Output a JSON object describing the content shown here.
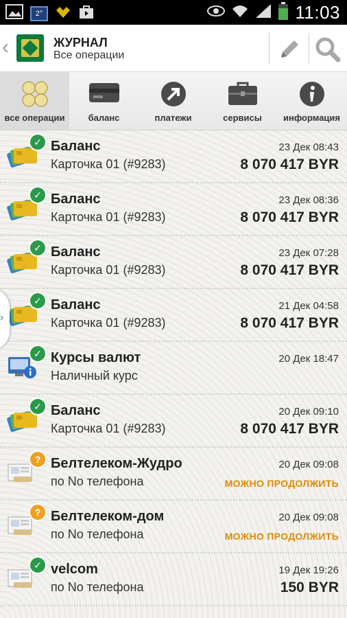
{
  "statusbar": {
    "temp": "2°",
    "time": "11:03",
    "icons": [
      "gallery-icon",
      "temperature-icon",
      "heart-icon",
      "store-icon",
      "eye-icon",
      "wifi-icon",
      "signal-icon",
      "battery-icon"
    ]
  },
  "appbar": {
    "title": "ЖУРНАЛ",
    "subtitle": "Все операции",
    "icons": [
      "back-icon",
      "bank-logo",
      "pencil-icon",
      "search-icon"
    ]
  },
  "tabs": [
    {
      "label": "все операции",
      "icon": "all-operations-icon",
      "active": true
    },
    {
      "label": "баланс",
      "icon": "card-icon",
      "active": false
    },
    {
      "label": "платежи",
      "icon": "payment-arrow-icon",
      "active": false
    },
    {
      "label": "сервисы",
      "icon": "briefcase-icon",
      "active": false
    },
    {
      "label": "информация",
      "icon": "info-icon",
      "active": false
    }
  ],
  "operations": [
    {
      "name": "Баланс",
      "desc": "Карточка 01 (#9283)",
      "date": "23 Дек 08:43",
      "amount": "8 070 417 BYR",
      "status": "ok",
      "icon": "cards-icon"
    },
    {
      "name": "Баланс",
      "desc": "Карточка 01 (#9283)",
      "date": "23 Дек 08:36",
      "amount": "8 070 417 BYR",
      "status": "ok",
      "icon": "cards-icon"
    },
    {
      "name": "Баланс",
      "desc": "Карточка 01 (#9283)",
      "date": "23 Дек 07:28",
      "amount": "8 070 417 BYR",
      "status": "ok",
      "icon": "cards-icon"
    },
    {
      "name": "Баланс",
      "desc": "Карточка 01 (#9283)",
      "date": "21 Дек 04:58",
      "amount": "8 070 417 BYR",
      "status": "ok",
      "icon": "cards-icon"
    },
    {
      "name": "Курсы валют",
      "desc": "Наличный курс",
      "date": "20 Дек 18:47",
      "amount": "",
      "status": "ok",
      "icon": "exchange-rates-icon"
    },
    {
      "name": "Баланс",
      "desc": "Карточка 01 (#9283)",
      "date": "20 Дек 09:10",
      "amount": "8 070 417 BYR",
      "status": "ok",
      "icon": "cards-icon"
    },
    {
      "name": "Белтелеком-Жудро",
      "desc": "по No телефона",
      "date": "20 Дек 09:08",
      "continue": "МОЖНО ПРОДОЛЖИТЬ",
      "status": "pending",
      "icon": "payment-terminal-icon"
    },
    {
      "name": "Белтелеком-дом",
      "desc": "по No телефона",
      "date": "20 Дек 09:08",
      "continue": "МОЖНО ПРОДОЛЖИТЬ",
      "status": "pending",
      "icon": "payment-terminal-icon"
    },
    {
      "name": "velcom",
      "desc": "по No телефона",
      "date": "19 Дек 19:26",
      "amount": "150 BYR",
      "status": "ok",
      "icon": "payment-terminal-icon"
    }
  ],
  "side_handle_icon": "chevron-right-icon",
  "colors": {
    "accent_green": "#0b7a3a",
    "continue_orange": "#e08a00",
    "ok_green": "#2a9a4a",
    "pending_orange": "#f0a020"
  }
}
